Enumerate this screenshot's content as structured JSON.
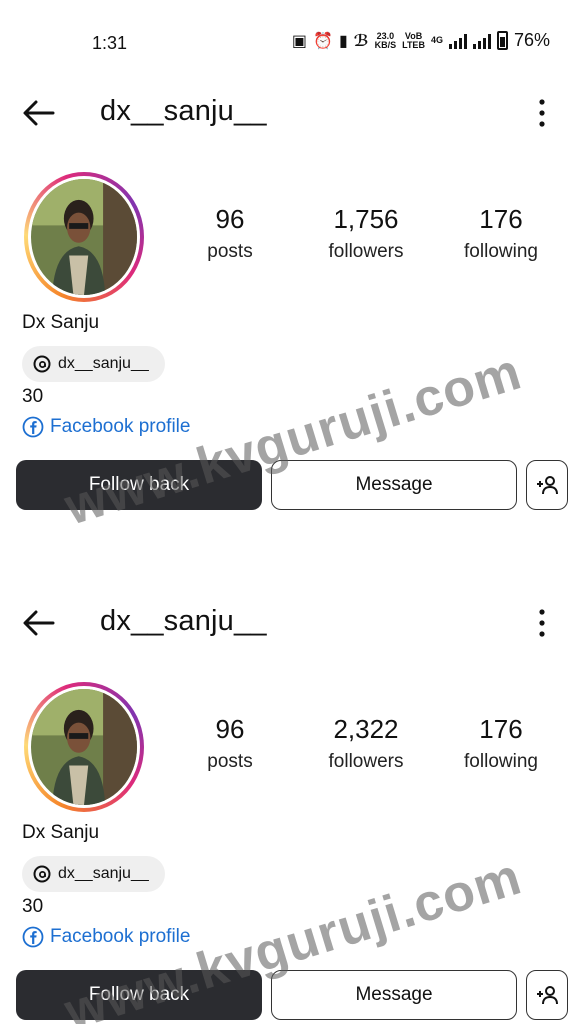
{
  "status_bar": {
    "time": "1:31",
    "net_speed": "23.0",
    "net_speed_unit": "KB/S",
    "volte_top": "VoB",
    "volte_bottom": "LTEB",
    "network_type": "4G",
    "battery": "76%"
  },
  "profiles": [
    {
      "username": "dx__sanju__",
      "stats": {
        "posts": {
          "value": "96",
          "label": "posts"
        },
        "followers": {
          "value": "1,756",
          "label": "followers"
        },
        "following": {
          "value": "176",
          "label": "following"
        }
      },
      "name": "Dx Sanju",
      "threads_handle": "dx__sanju__",
      "bio": "30",
      "facebook_link": "Facebook profile",
      "buttons": {
        "follow": "Follow back",
        "message": "Message"
      }
    },
    {
      "username": "dx__sanju__",
      "stats": {
        "posts": {
          "value": "96",
          "label": "posts"
        },
        "followers": {
          "value": "2,322",
          "label": "followers"
        },
        "following": {
          "value": "176",
          "label": "following"
        }
      },
      "name": "Dx Sanju",
      "threads_handle": "dx__sanju__",
      "bio": "30",
      "facebook_link": "Facebook profile",
      "buttons": {
        "follow": "Follow back",
        "message": "Message"
      }
    }
  ],
  "watermark": "www.kvguruji.com",
  "colors": {
    "follow_button": "#2b2c30",
    "link": "#1d6fd1",
    "chip_bg": "#efefef"
  }
}
